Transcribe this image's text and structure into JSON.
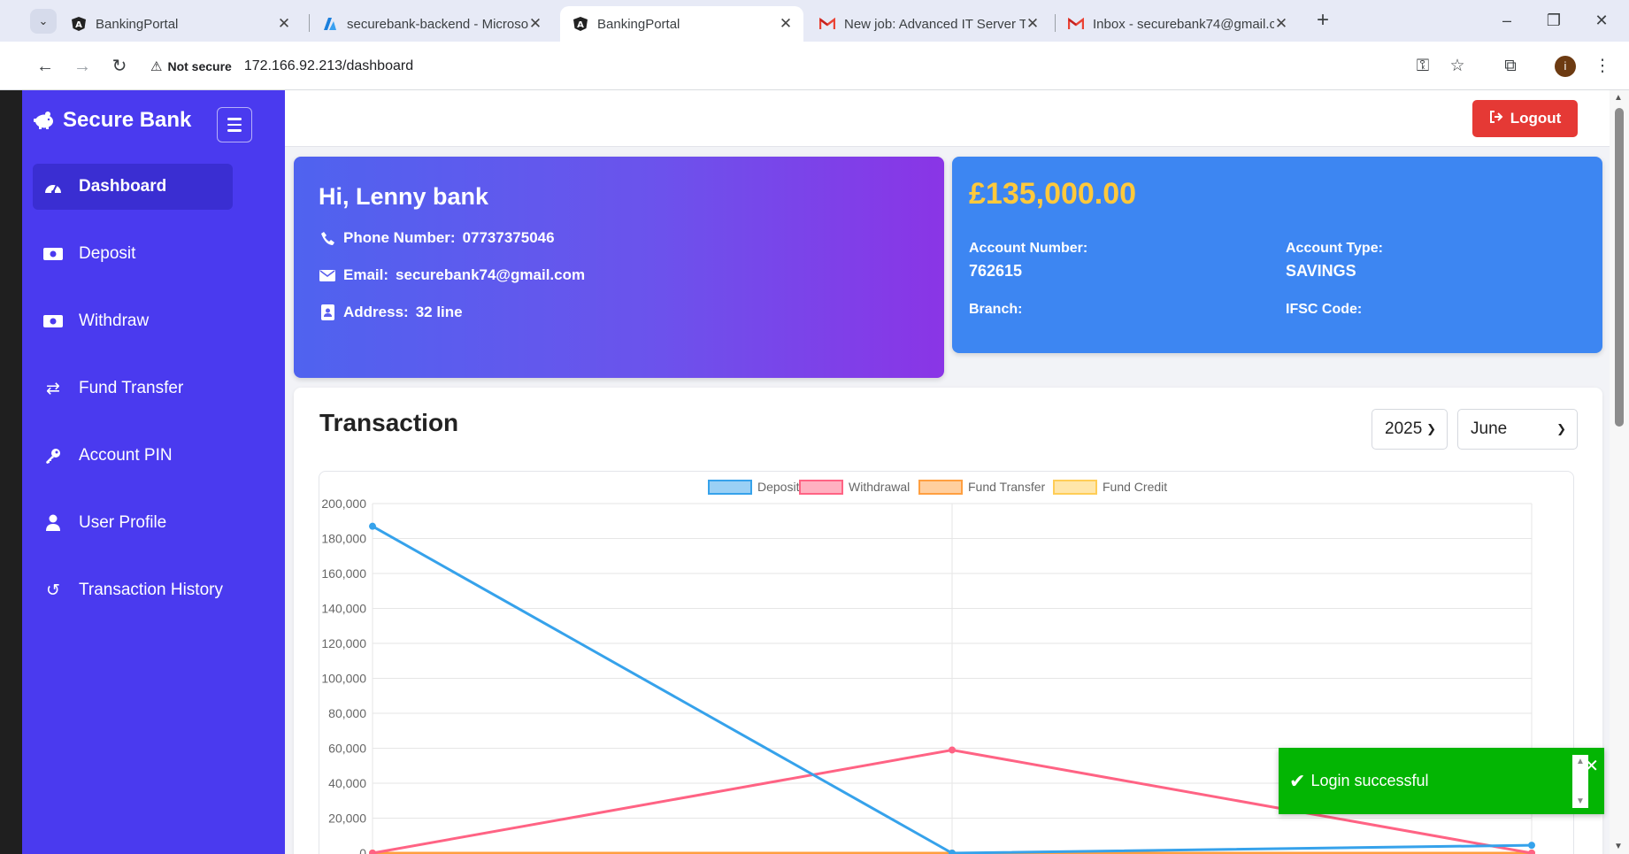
{
  "browser": {
    "tabs": [
      {
        "title": "BankingPortal",
        "icon": "angular-icon",
        "active": false
      },
      {
        "title": "securebank-backend - Microsof",
        "icon": "azure-icon",
        "active": false
      },
      {
        "title": "BankingPortal",
        "icon": "angular-icon",
        "active": true
      },
      {
        "title": "New job: Advanced IT Server Te",
        "icon": "gmail-icon",
        "active": false
      },
      {
        "title": "Inbox - securebank74@gmail.c",
        "icon": "gmail-icon",
        "active": false
      }
    ],
    "security_label": "Not secure",
    "url": "172.166.92.213/dashboard",
    "profile_initial": "i"
  },
  "sidebar": {
    "brand": "Secure Bank",
    "items": [
      {
        "label": "Dashboard",
        "icon": "gauge-icon",
        "active": true
      },
      {
        "label": "Deposit",
        "icon": "money-bill-icon",
        "active": false
      },
      {
        "label": "Withdraw",
        "icon": "money-bill-icon",
        "active": false
      },
      {
        "label": "Fund Transfer",
        "icon": "transfer-arrows-icon",
        "active": false
      },
      {
        "label": "Account PIN",
        "icon": "key-icon",
        "active": false
      },
      {
        "label": "User Profile",
        "icon": "user-icon",
        "active": false
      },
      {
        "label": "Transaction History",
        "icon": "history-icon",
        "active": false
      }
    ]
  },
  "header": {
    "logout_label": "Logout"
  },
  "user_card": {
    "greeting": "Hi, Lenny bank",
    "phone_label": "Phone Number:",
    "phone": "07737375046",
    "email_label": "Email:",
    "email": "securebank74@gmail.com",
    "address_label": "Address:",
    "address": "32 line"
  },
  "account_card": {
    "balance": "£135,000.00",
    "account_number_label": "Account Number:",
    "account_number": "762615",
    "account_type_label": "Account Type:",
    "account_type": "SAVINGS",
    "branch_label": "Branch:",
    "ifsc_label": "IFSC Code:"
  },
  "transaction": {
    "title": "Transaction",
    "year": "2025",
    "month": "June"
  },
  "toast": {
    "message": "Login successful"
  },
  "colors": {
    "sidebar": "#4a3aef",
    "deposit": "#36a2eb",
    "withdrawal": "#ff6384",
    "fund_transfer": "#ff9f40",
    "fund_credit": "#ffcd56",
    "logout": "#e53935",
    "toast": "#03b503",
    "balance": "#ffc93c"
  },
  "chart_data": {
    "type": "line",
    "x": [
      "",
      "",
      ""
    ],
    "ylim": [
      0,
      200000
    ],
    "yticks": [
      "200,000",
      "180,000",
      "160,000",
      "140,000",
      "120,000",
      "100,000",
      "80,000",
      "60,000",
      "40,000",
      "20,000",
      "0"
    ],
    "grid": true,
    "legend_position": "top",
    "series": [
      {
        "name": "Deposit",
        "color": "#36a2eb",
        "values": [
          187000,
          0,
          4500
        ]
      },
      {
        "name": "Withdrawal",
        "color": "#ff6384",
        "values": [
          0,
          59000,
          0
        ]
      },
      {
        "name": "Fund Transfer",
        "color": "#ff9f40",
        "values": [
          0,
          0,
          0
        ]
      },
      {
        "name": "Fund Credit",
        "color": "#ffcd56",
        "values": [
          0,
          0,
          0
        ]
      }
    ]
  }
}
